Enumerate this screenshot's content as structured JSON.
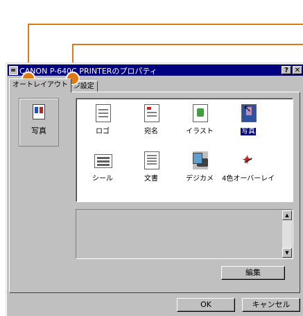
{
  "window": {
    "title": "CANON P-640C PRINTERのプロパティ",
    "help_button": "?",
    "close_button": "✕"
  },
  "tabs": [
    {
      "label": "オートレイアウト"
    },
    {
      "label": "ページ設定"
    }
  ],
  "selected": {
    "label": "写真",
    "icon": "photo-icon"
  },
  "gallery": {
    "items": [
      {
        "label": "ロゴ",
        "icon": "logo-icon"
      },
      {
        "label": "宛名",
        "icon": "address-icon"
      },
      {
        "label": "イラスト",
        "icon": "illustration-icon"
      },
      {
        "label": "写真",
        "icon": "photo-icon",
        "selected": true
      },
      {
        "label": "シール",
        "icon": "sticker-icon"
      },
      {
        "label": "文書",
        "icon": "document-icon"
      },
      {
        "label": "デジカメ",
        "icon": "digital-camera-icon"
      },
      {
        "label": "4色オーバーレイ",
        "icon": "overlay-icon"
      }
    ]
  },
  "buttons": {
    "edit": "編集",
    "ok": "OK",
    "cancel": "キャンセル"
  },
  "colors": {
    "titlebar": "#000080",
    "callout": "#e07818",
    "dialog": "#c0c0c0"
  }
}
